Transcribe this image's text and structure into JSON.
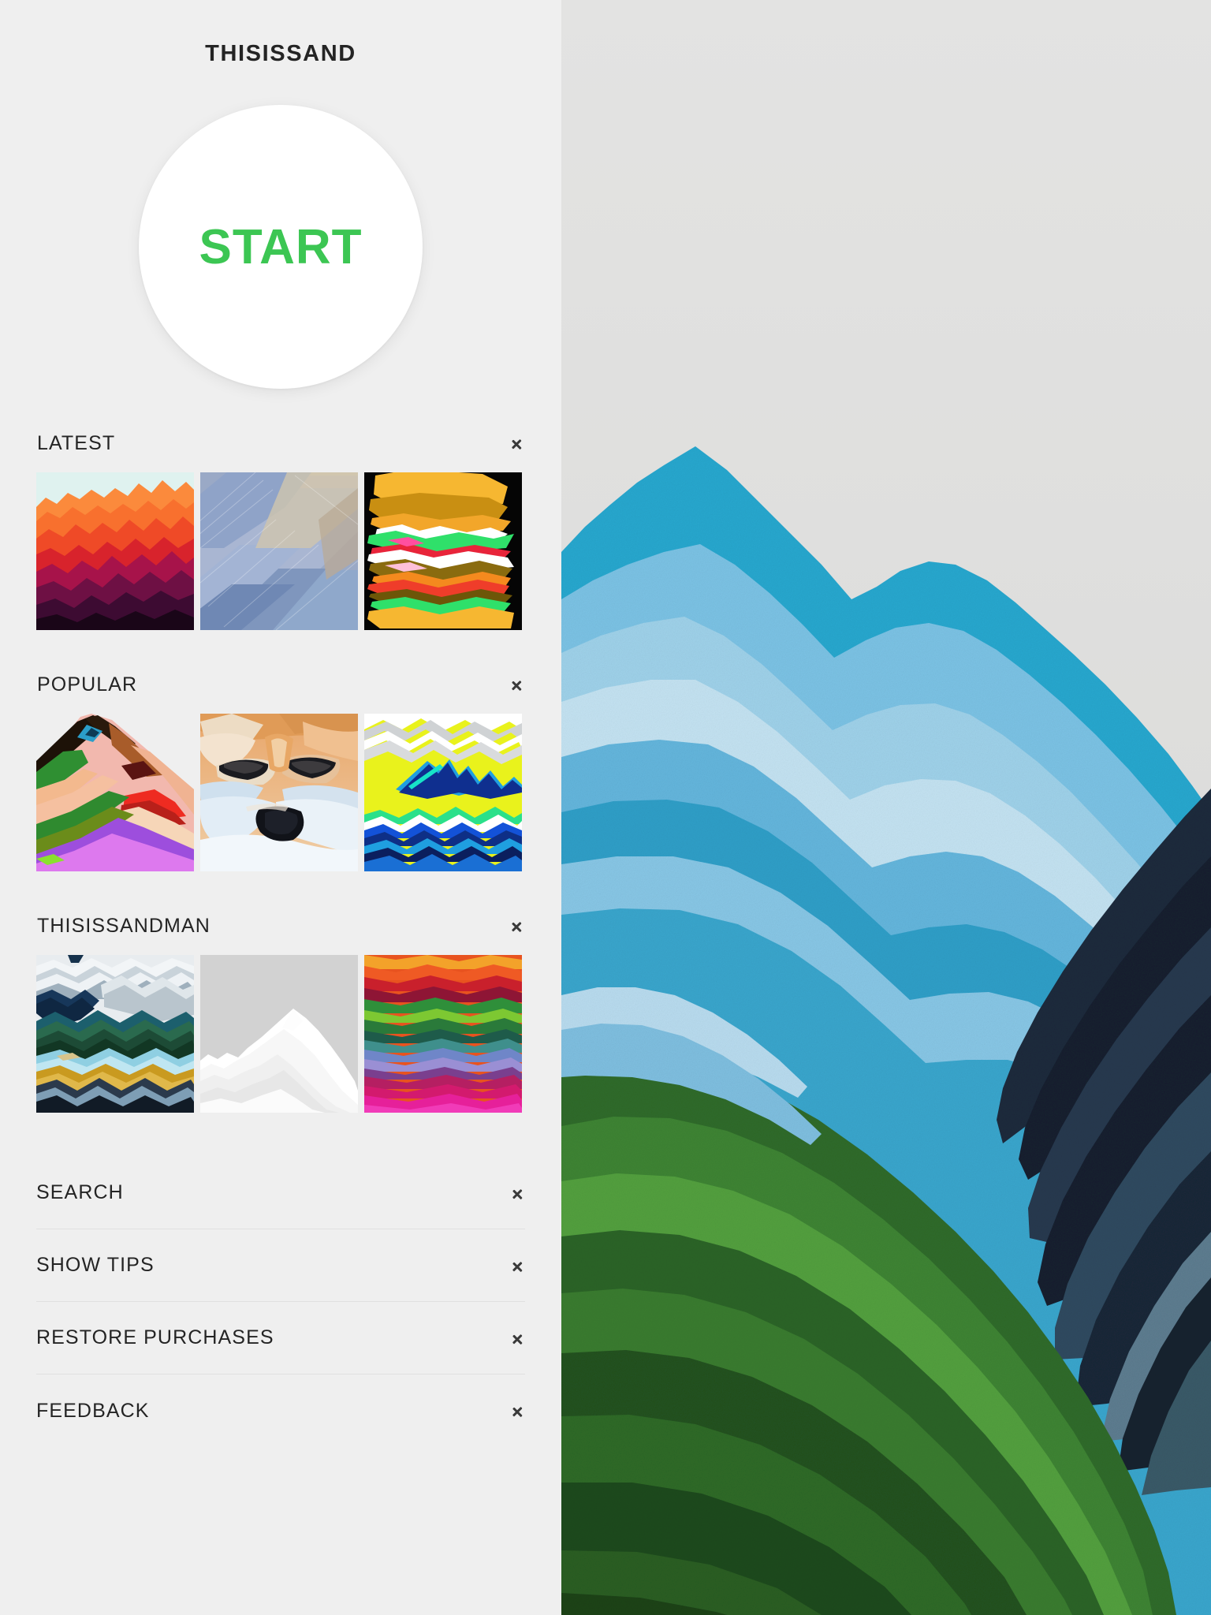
{
  "app": {
    "title": "THISISSAND",
    "accent_green": "#3cc653",
    "background": "#efefef",
    "text_color": "#242424"
  },
  "start": {
    "label": "START",
    "icon": "start-circle"
  },
  "sections": [
    {
      "title": "LATEST",
      "chevron_icon": "chevron-right-icon",
      "thumbs": [
        {
          "name": "orange-red-mountain-layers",
          "alt": "Orange and red layered mountain sand art"
        },
        {
          "name": "pastel-blue-diagonal-strata",
          "alt": "Pastel blue diagonal sand strata"
        },
        {
          "name": "black-yellow-green-stack",
          "alt": "Black background with yellow and green stacked waves"
        }
      ]
    },
    {
      "title": "POPULAR",
      "chevron_icon": "chevron-right-icon",
      "thumbs": [
        {
          "name": "pink-green-peak",
          "alt": "Pink and green angular mountain peak"
        },
        {
          "name": "fox-face-painting",
          "alt": "Painted fox face"
        },
        {
          "name": "yellow-neon-waves",
          "alt": "Neon yellow sky over blue wave layers"
        }
      ]
    },
    {
      "title": "THISISSANDMAN",
      "chevron_icon": "chevron-right-icon",
      "thumbs": [
        {
          "name": "alpine-lake-valley",
          "alt": "Blue green alpine valley with gold foreground"
        },
        {
          "name": "white-snow-peak",
          "alt": "White snowy peak on grey sky"
        },
        {
          "name": "rainbow-strata",
          "alt": "Rainbow coloured horizontal strata"
        }
      ]
    }
  ],
  "menu": [
    {
      "label": "SEARCH",
      "chevron_icon": "chevron-right-icon"
    },
    {
      "label": "SHOW TIPS",
      "chevron_icon": "chevron-right-icon"
    },
    {
      "label": "RESTORE PURCHASES",
      "chevron_icon": "chevron-right-icon"
    },
    {
      "label": "FEEDBACK",
      "chevron_icon": "chevron-right-icon"
    }
  ],
  "canvas": {
    "name": "sand-artwork-canvas",
    "description": "Blue, navy and green layered sand mountain landscape on pale grey sky"
  }
}
